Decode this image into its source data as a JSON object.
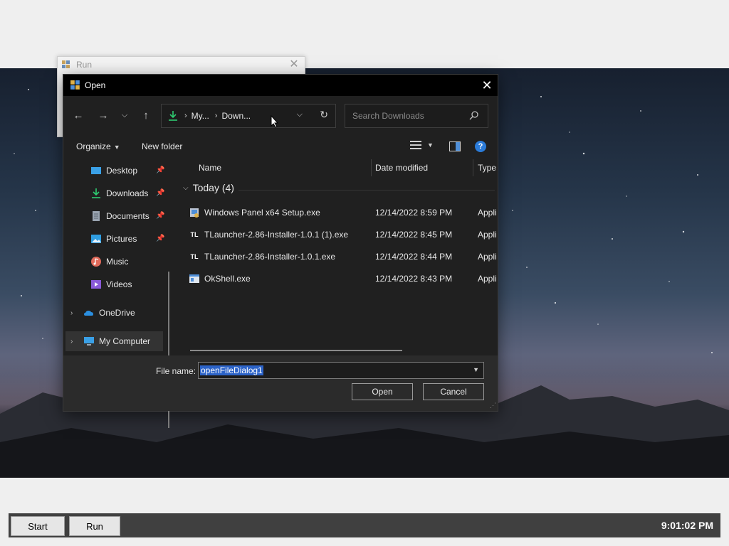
{
  "run_window": {
    "title": "Run"
  },
  "dialog": {
    "title": "Open",
    "breadcrumb": [
      "My...",
      "Down..."
    ],
    "search_placeholder": "Search Downloads",
    "toolbar": {
      "organize_label": "Organize",
      "new_folder_label": "New folder"
    },
    "nav_items": [
      {
        "label": "Desktop",
        "icon": "desktop-icon",
        "pinned": true
      },
      {
        "label": "Downloads",
        "icon": "downloads-icon",
        "pinned": true
      },
      {
        "label": "Documents",
        "icon": "documents-icon",
        "pinned": true
      },
      {
        "label": "Pictures",
        "icon": "pictures-icon",
        "pinned": true
      },
      {
        "label": "Music",
        "icon": "music-icon",
        "pinned": false
      },
      {
        "label": "Videos",
        "icon": "videos-icon",
        "pinned": false
      },
      {
        "label": "OneDrive",
        "icon": "onedrive-icon",
        "expandable": true
      },
      {
        "label": "My Computer",
        "icon": "computer-icon",
        "expandable": true,
        "selected": true
      }
    ],
    "columns": {
      "name": "Name",
      "date": "Date modified",
      "type": "Type"
    },
    "group_label": "Today (4)",
    "files": [
      {
        "name": "Windows Panel x64 Setup.exe",
        "date": "12/14/2022 8:59 PM",
        "type": "Appli",
        "icon": "installer-icon"
      },
      {
        "name": "TLauncher-2.86-Installer-1.0.1 (1).exe",
        "date": "12/14/2022 8:45 PM",
        "type": "Appli",
        "icon": "tlauncher-icon"
      },
      {
        "name": "TLauncher-2.86-Installer-1.0.1.exe",
        "date": "12/14/2022 8:44 PM",
        "type": "Appli",
        "icon": "tlauncher-icon"
      },
      {
        "name": "OkShell.exe",
        "date": "12/14/2022 8:43 PM",
        "type": "Appli",
        "icon": "app-window-icon"
      }
    ],
    "file_name_label": "File name:",
    "file_name_value": "openFileDialog1",
    "open_label": "Open",
    "cancel_label": "Cancel"
  },
  "taskbar": {
    "start_label": "Start",
    "run_label": "Run",
    "clock": "9:01:02 PM"
  },
  "colors": {
    "accent": "#2b7bd8",
    "selection": "#2c63c8",
    "dialog_bg": "#202020",
    "taskbar_bg": "#404040"
  }
}
